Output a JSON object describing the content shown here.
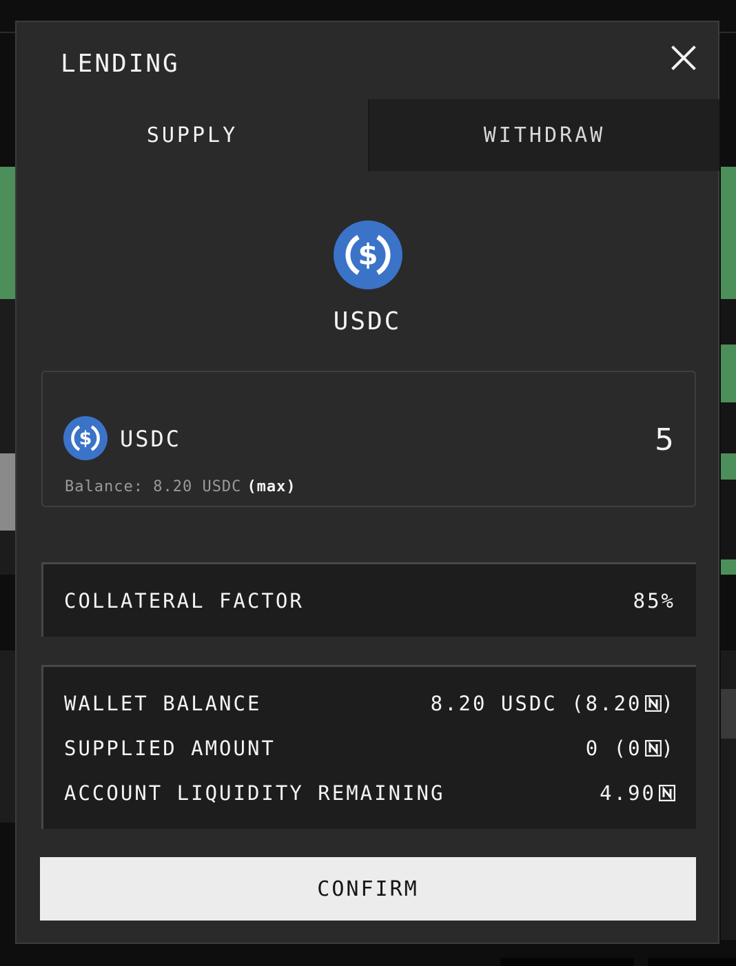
{
  "modal": {
    "title": "LENDING"
  },
  "tabs": [
    {
      "label": "SUPPLY",
      "active": true
    },
    {
      "label": "WITHDRAW",
      "active": false
    }
  ],
  "asset": {
    "symbol": "USDC",
    "logo_icon": "usdc-icon",
    "logo_color": "#3b73c8"
  },
  "input": {
    "symbol": "USDC",
    "amount": "5",
    "balance_label": "Balance:",
    "balance_value": "8.20 USDC",
    "max_label": "(max)"
  },
  "collateral": {
    "label": "COLLATERAL FACTOR",
    "value": "85%"
  },
  "stats": {
    "wallet_balance": {
      "label": "WALLET BALANCE",
      "value": "8.20 USDC (8.20",
      "suffix": ")"
    },
    "supplied_amount": {
      "label": "SUPPLIED AMOUNT",
      "value": "0 (0",
      "suffix": ")"
    },
    "liquidity_remaining": {
      "label": "ACCOUNT LIQUIDITY REMAINING",
      "value": "4.90",
      "suffix": ""
    }
  },
  "confirm_label": "CONFIRM",
  "colors": {
    "modal_bg": "#2a2a2a",
    "panel_bg": "#1d1d1d",
    "confirm_bg": "#ececec",
    "usdc_blue": "#3b73c8"
  }
}
